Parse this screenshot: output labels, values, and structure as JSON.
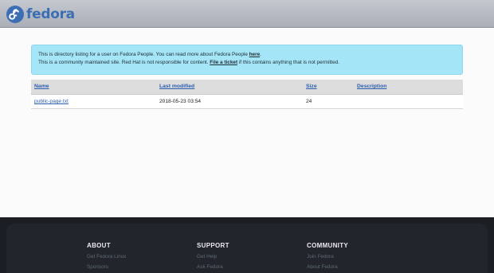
{
  "header": {
    "logo_text": "fedora"
  },
  "notice": {
    "line1_text": "This is directory listing for a user on Fedora People. You can read more about Fedora People ",
    "line1_link": "here",
    "line1_end": ".",
    "line2_text": "This is a community maintained site. Red Hat is not responsible for content. ",
    "line2_link": "File a ticket",
    "line2_end": " if this contains anything that is not permitted."
  },
  "table": {
    "columns": [
      "Name",
      "Last modified",
      "Size",
      "Description"
    ],
    "rows": [
      {
        "name": "public-page.txt",
        "modified": "2018-05-23 03:54",
        "size": "24",
        "description": ""
      }
    ]
  },
  "footer": {
    "columns": [
      {
        "heading": "ABOUT",
        "links": [
          "Get Fedora Linux",
          "Sponsors"
        ]
      },
      {
        "heading": "SUPPORT",
        "links": [
          "Get Help",
          "Ask Fedora"
        ]
      },
      {
        "heading": "COMMUNITY",
        "links": [
          "Join Fedora",
          "About Fedora"
        ]
      }
    ]
  },
  "colors": {
    "brand": "#3c6eb4",
    "notice_bg": "#a5e5f8",
    "link": "#2a5db0",
    "footer_bg": "#1b1e23"
  }
}
